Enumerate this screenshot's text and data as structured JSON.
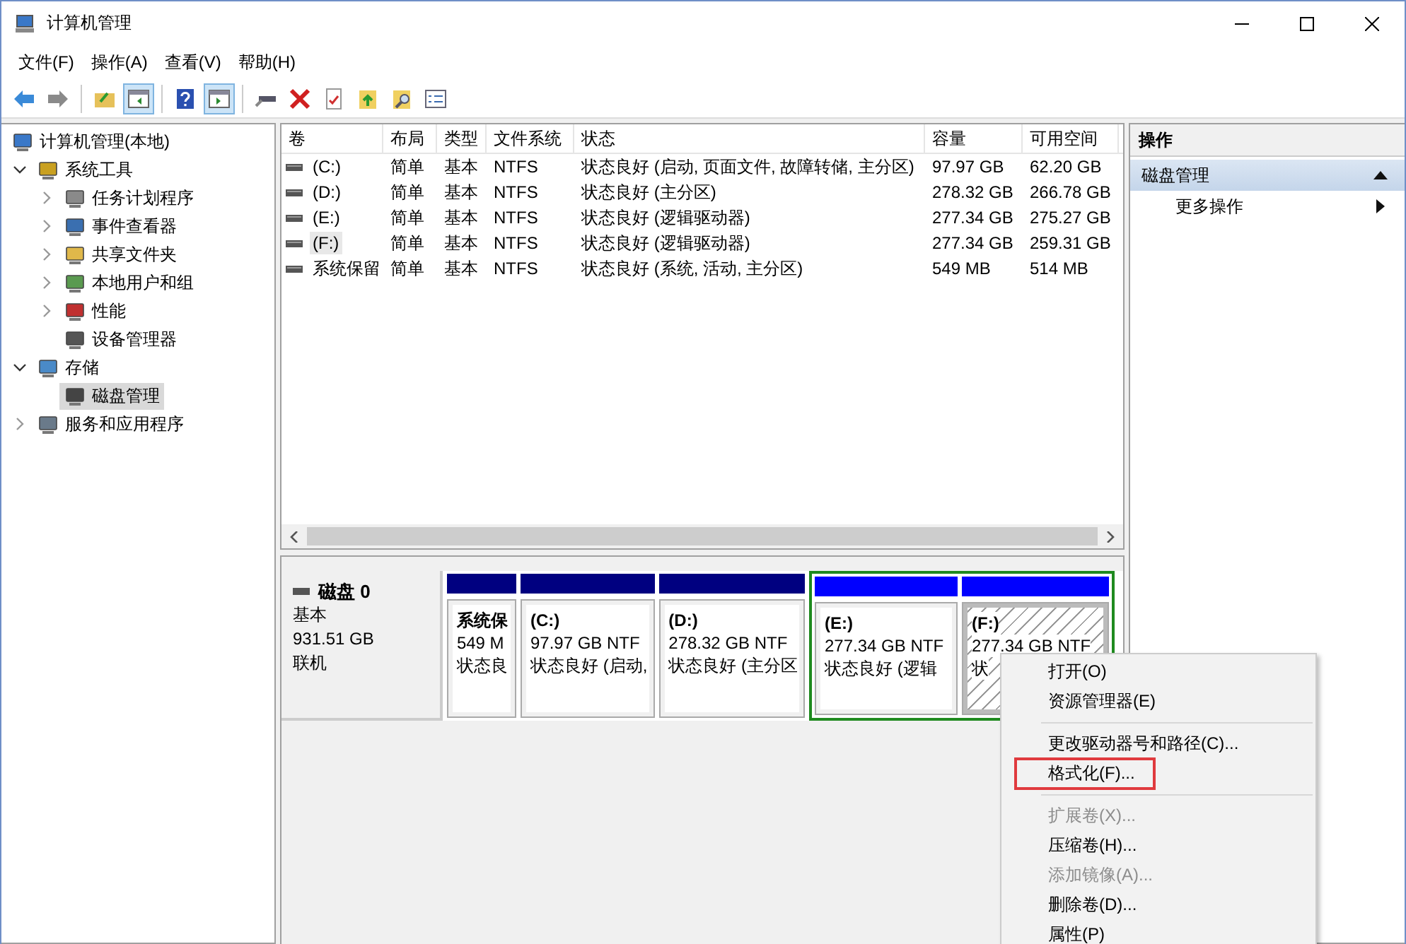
{
  "window": {
    "title": "计算机管理"
  },
  "menu": [
    "文件(F)",
    "操作(A)",
    "查看(V)",
    "帮助(H)"
  ],
  "toolbar": [
    {
      "kind": "back",
      "selected": false
    },
    {
      "kind": "forward",
      "selected": false
    },
    {
      "kind": "separator"
    },
    {
      "kind": "up",
      "selected": false
    },
    {
      "kind": "tree-pane",
      "selected": true
    },
    {
      "kind": "separator"
    },
    {
      "kind": "help",
      "selected": false
    },
    {
      "kind": "action-pane",
      "selected": true
    },
    {
      "kind": "separator"
    },
    {
      "kind": "connect",
      "selected": false
    },
    {
      "kind": "delete",
      "selected": false
    },
    {
      "kind": "properties",
      "selected": false
    },
    {
      "kind": "import",
      "selected": false
    },
    {
      "kind": "search",
      "selected": false
    },
    {
      "kind": "checklist",
      "selected": false
    }
  ],
  "tree": [
    {
      "label": "计算机管理(本地)",
      "kind": "root",
      "selected": false,
      "children": [
        {
          "label": "系统工具",
          "kind": "branch",
          "expanded": true,
          "selected": false,
          "children": [
            {
              "label": "任务计划程序",
              "kind": "branch",
              "expanded": false,
              "selected": false
            },
            {
              "label": "事件查看器",
              "kind": "branch",
              "expanded": false,
              "selected": false
            },
            {
              "label": "共享文件夹",
              "kind": "branch",
              "expanded": false,
              "selected": false
            },
            {
              "label": "本地用户和组",
              "kind": "branch",
              "expanded": false,
              "selected": false
            },
            {
              "label": "性能",
              "kind": "branch",
              "expanded": false,
              "selected": false
            },
            {
              "label": "设备管理器",
              "kind": "leaf",
              "selected": false
            }
          ]
        },
        {
          "label": "存储",
          "kind": "branch",
          "expanded": true,
          "selected": false,
          "children": [
            {
              "label": "磁盘管理",
              "kind": "leaf",
              "selected": true
            }
          ]
        },
        {
          "label": "服务和应用程序",
          "kind": "branch",
          "expanded": false,
          "selected": false
        }
      ]
    }
  ],
  "table": {
    "columns": [
      "卷",
      "布局",
      "类型",
      "文件系统",
      "状态",
      "容量",
      "可用空间"
    ],
    "rows": [
      {
        "cells": [
          "(C:)",
          "简单",
          "基本",
          "NTFS",
          "状态良好 (启动, 页面文件, 故障转储, 主分区)",
          "97.97 GB",
          "62.20 GB"
        ],
        "selected": false
      },
      {
        "cells": [
          "(D:)",
          "简单",
          "基本",
          "NTFS",
          "状态良好 (主分区)",
          "278.32 GB",
          "266.78 GB"
        ],
        "selected": false
      },
      {
        "cells": [
          "(E:)",
          "简单",
          "基本",
          "NTFS",
          "状态良好 (逻辑驱动器)",
          "277.34 GB",
          "275.27 GB"
        ],
        "selected": false
      },
      {
        "cells": [
          "(F:)",
          "简单",
          "基本",
          "NTFS",
          "状态良好 (逻辑驱动器)",
          "277.34 GB",
          "259.31 GB"
        ],
        "selected": true
      },
      {
        "cells": [
          "系统保留",
          "简单",
          "基本",
          "NTFS",
          "状态良好 (系统, 活动, 主分区)",
          "549 MB",
          "514 MB"
        ],
        "selected": false
      }
    ]
  },
  "disk": {
    "name": "磁盘 0",
    "type": "基本",
    "size": "931.51 GB",
    "status": "联机",
    "partitions": [
      {
        "name": "系统保",
        "size": "549 M",
        "status": "状态良",
        "kind": "primary",
        "selected": false
      },
      {
        "name": "(C:)",
        "size": "97.97 GB NTF",
        "status": "状态良好 (启动,",
        "kind": "primary",
        "selected": false
      },
      {
        "name": "(D:)",
        "size": "278.32 GB NTF",
        "status": "状态良好 (主分区",
        "kind": "primary",
        "selected": false
      },
      {
        "name": "(E:)",
        "size": "277.34 GB NTF",
        "status": "状态良好 (逻辑",
        "kind": "logical",
        "selected": false
      },
      {
        "name": "(F:)",
        "size": "277.34 GB NTF",
        "status": "状",
        "kind": "logical",
        "selected": true
      }
    ]
  },
  "actions": {
    "title": "操作",
    "section": {
      "label": "磁盘管理",
      "expanded": true
    },
    "items": [
      "更多操作"
    ]
  },
  "context_menu": [
    {
      "kind": "item",
      "label": "打开(O)",
      "disabled": false,
      "highlighted": false
    },
    {
      "kind": "item",
      "label": "资源管理器(E)",
      "disabled": false,
      "highlighted": false
    },
    {
      "kind": "separator"
    },
    {
      "kind": "item",
      "label": "更改驱动器号和路径(C)...",
      "disabled": false,
      "highlighted": false
    },
    {
      "kind": "item",
      "label": "格式化(F)...",
      "disabled": false,
      "highlighted": true
    },
    {
      "kind": "separator"
    },
    {
      "kind": "item",
      "label": "扩展卷(X)...",
      "disabled": true,
      "highlighted": false
    },
    {
      "kind": "item",
      "label": "压缩卷(H)...",
      "disabled": false,
      "highlighted": false
    },
    {
      "kind": "item",
      "label": "添加镜像(A)...",
      "disabled": true,
      "highlighted": false
    },
    {
      "kind": "item",
      "label": "删除卷(D)...",
      "disabled": false,
      "highlighted": false
    },
    {
      "kind": "item",
      "label": "属性(P)",
      "disabled": false,
      "highlighted": false
    }
  ]
}
